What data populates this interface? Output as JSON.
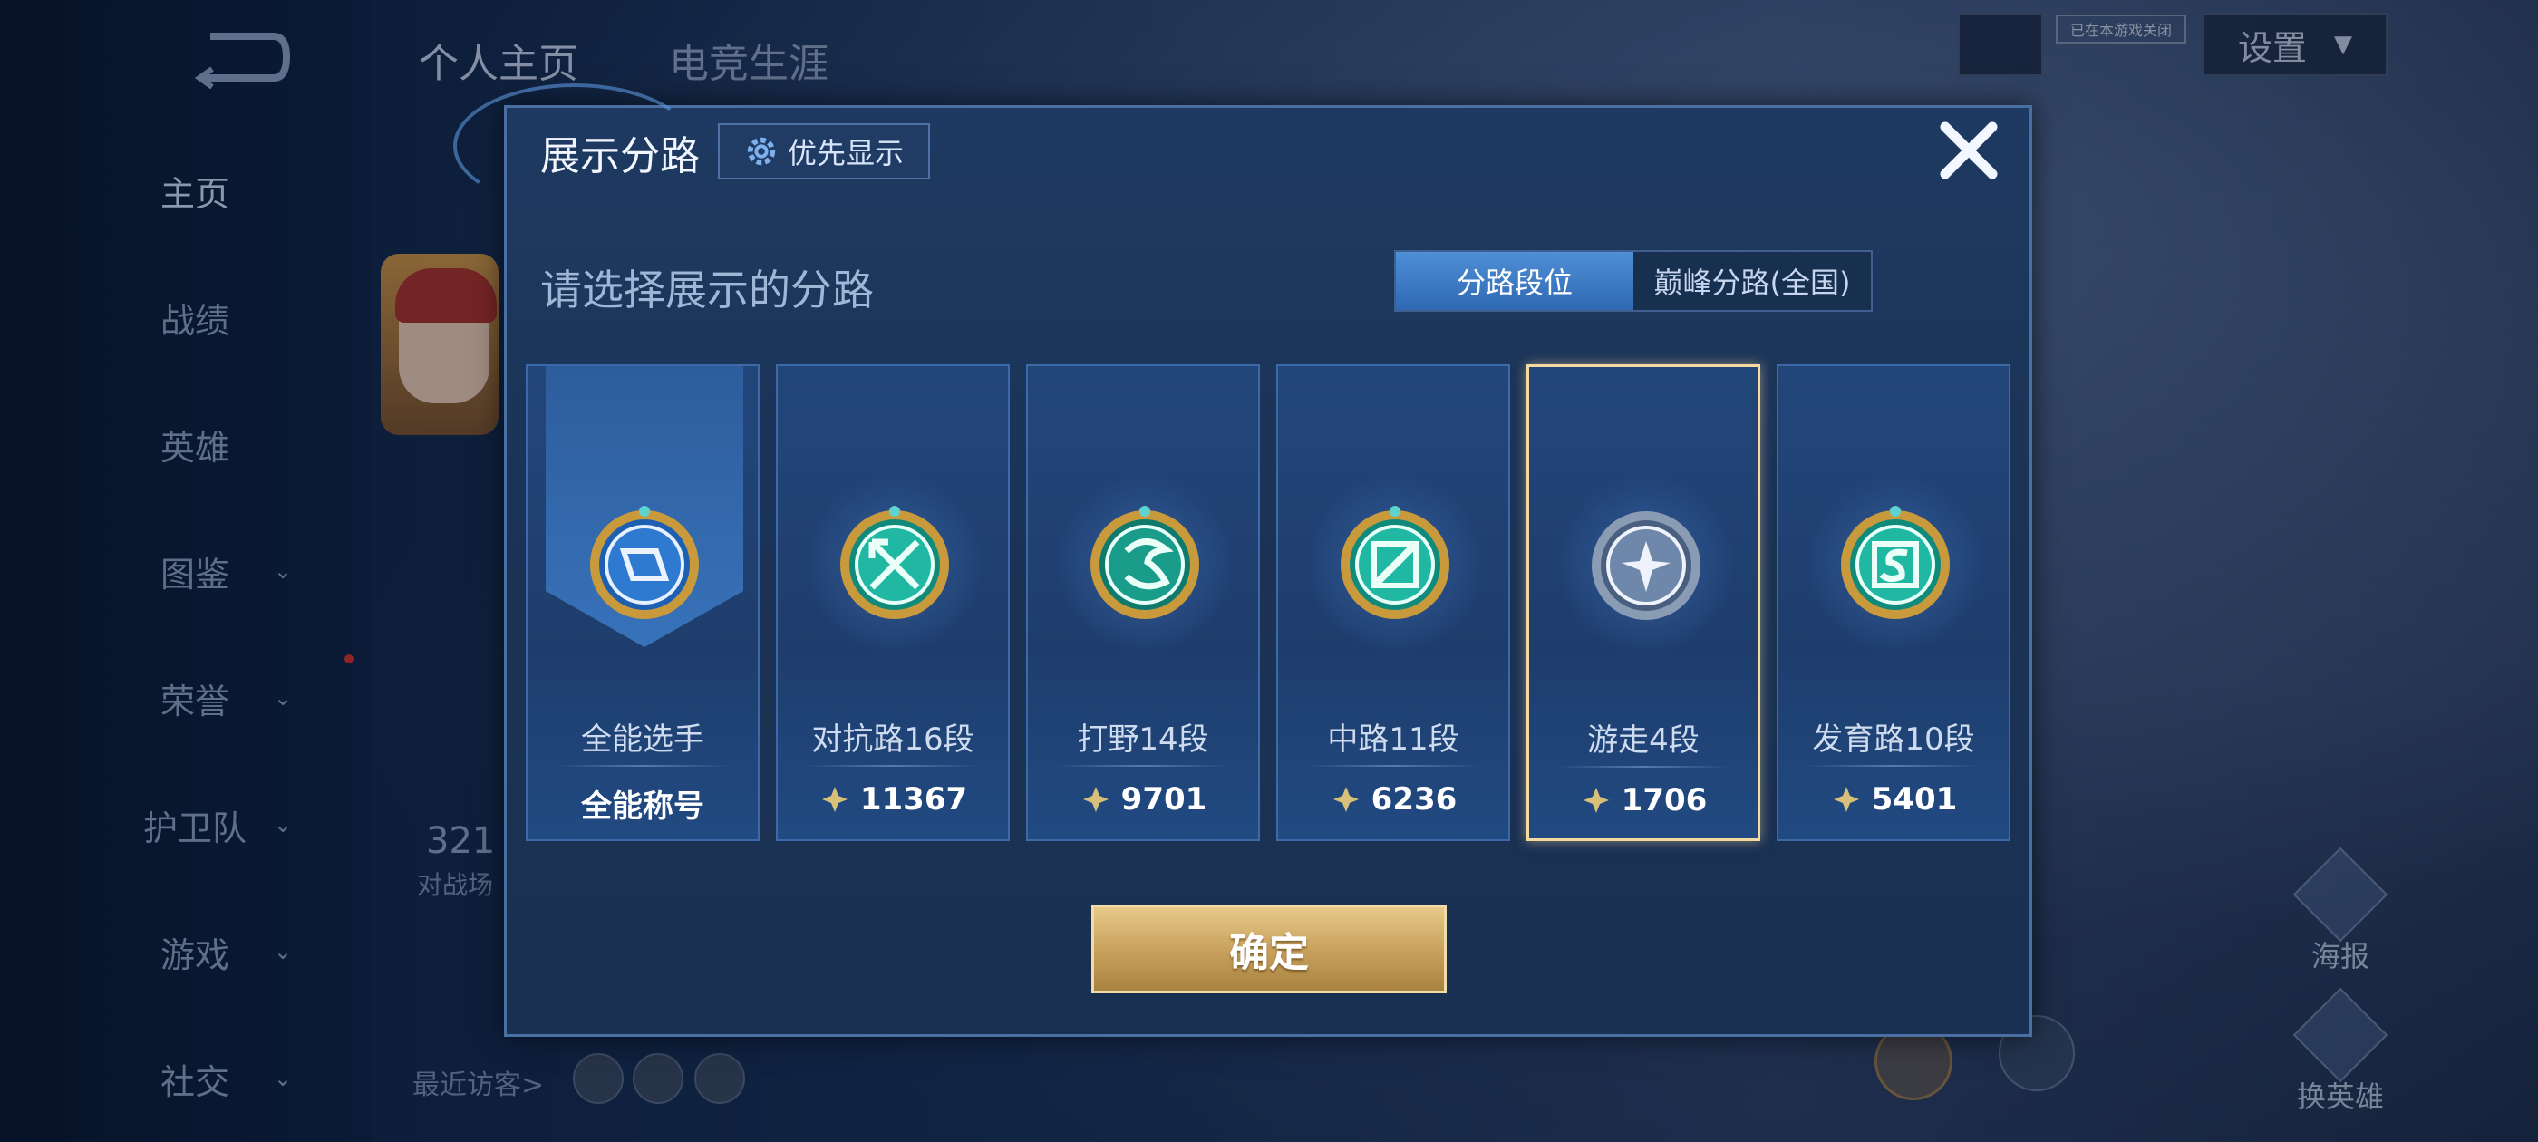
{
  "background": {
    "top_tabs": [
      "个人主页",
      "电竞生涯"
    ],
    "settings_label": "设置",
    "notice_label": "已在本游戏关闭",
    "sidebar": [
      {
        "label": "主页",
        "expandable": false
      },
      {
        "label": "战绩",
        "expandable": false
      },
      {
        "label": "英雄",
        "expandable": false
      },
      {
        "label": "图鉴",
        "expandable": true
      },
      {
        "label": "荣誉",
        "expandable": true
      },
      {
        "label": "护卫队",
        "expandable": true
      },
      {
        "label": "游戏",
        "expandable": true
      },
      {
        "label": "社交",
        "expandable": true
      }
    ],
    "stat_number": "321",
    "stat_label": "对战场",
    "recent_visitors_label": "最近访客>",
    "right_actions": [
      "海报",
      "换英雄"
    ]
  },
  "modal": {
    "title": "展示分路",
    "priority_button": "优先显示",
    "subtitle": "请选择展示的分路",
    "toggle": {
      "options": [
        "分路段位",
        "巅峰分路(全国)"
      ],
      "selected": "分路段位"
    },
    "cards": [
      {
        "label": "全能选手",
        "value": "全能称号",
        "has_score_icon": false,
        "selected": false,
        "badge": "all-round-badge"
      },
      {
        "label": "对抗路16段",
        "value": "11367",
        "has_score_icon": true,
        "selected": false,
        "badge": "clash-lane-badge"
      },
      {
        "label": "打野14段",
        "value": "9701",
        "has_score_icon": true,
        "selected": false,
        "badge": "jungle-badge"
      },
      {
        "label": "中路11段",
        "value": "6236",
        "has_score_icon": true,
        "selected": false,
        "badge": "mid-lane-badge"
      },
      {
        "label": "游走4段",
        "value": "1706",
        "has_score_icon": true,
        "selected": true,
        "badge": "roam-badge"
      },
      {
        "label": "发育路10段",
        "value": "5401",
        "has_score_icon": true,
        "selected": false,
        "badge": "farm-lane-badge"
      }
    ],
    "confirm_button": "确定"
  },
  "colors": {
    "accent_blue": "#3a7fd0",
    "gold": "#d2ad68",
    "selected_border": "#f4d9a0"
  }
}
